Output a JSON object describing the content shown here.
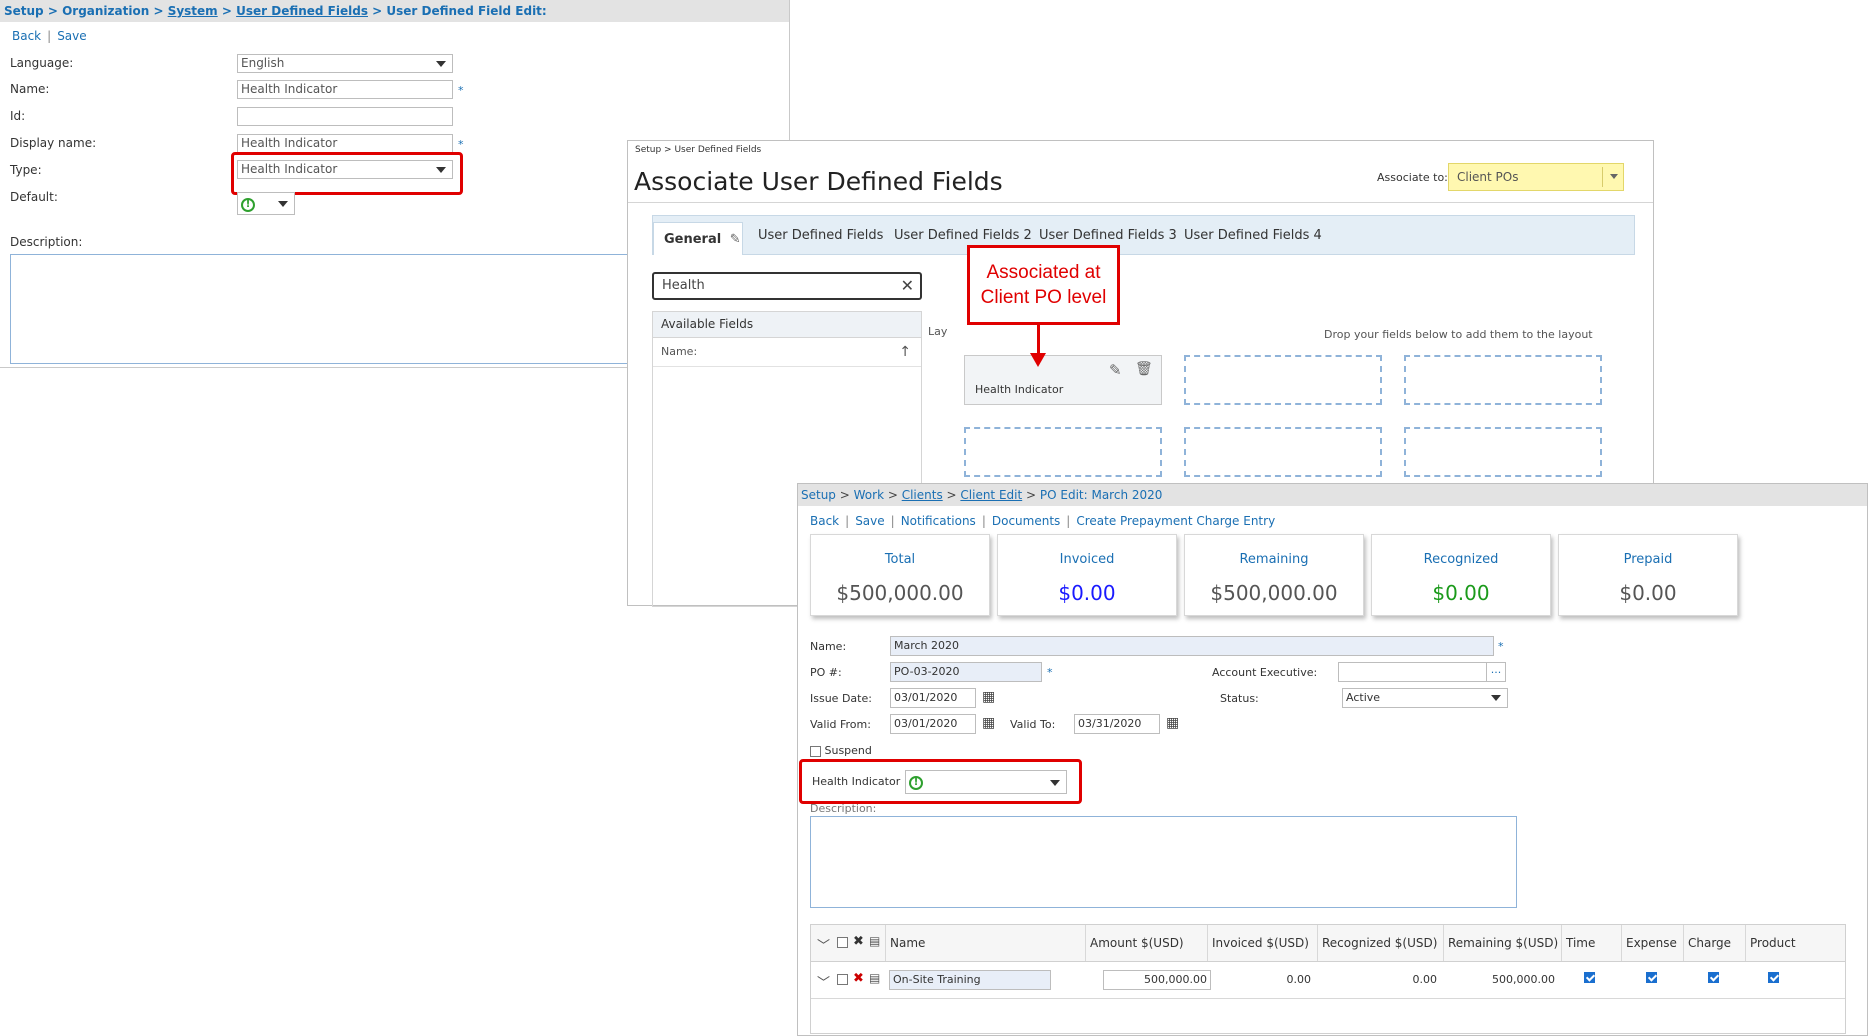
{
  "udf_edit": {
    "breadcrumb": [
      "Setup",
      "Organization",
      "System",
      "User Defined Fields",
      "User Defined Field Edit:"
    ],
    "actions": [
      "Back",
      "Save"
    ],
    "fields": {
      "language_label": "Language:",
      "language_value": "English",
      "name_label": "Name:",
      "name_value": "Health Indicator",
      "id_label": "Id:",
      "id_value": "",
      "display_label": "Display name:",
      "display_value": "Health Indicator",
      "type_label": "Type:",
      "type_value": "Health Indicator",
      "default_label": "Default:",
      "description_label": "Description:"
    },
    "required_mark": "*"
  },
  "associate": {
    "breadcrumb": "Setup > User Defined Fields",
    "title": "Associate User Defined Fields",
    "associate_label": "Associate to:",
    "associate_value": "Client POs",
    "tabs": [
      "General",
      "User Defined Fields",
      "User Defined Fields 2",
      "User Defined Fields 3",
      "User Defined Fields 4"
    ],
    "search_value": "Health",
    "available_header": "Available Fields",
    "name_column": "Name:",
    "layout_label": "Lay",
    "drop_hint": "Drop your fields below to add them to the layout",
    "placed_field": "Health Indicator",
    "highlight_color": "#fff8b0"
  },
  "callout": {
    "line1": "Associated at",
    "line2": "Client PO level",
    "color": "#e00000"
  },
  "po_edit": {
    "breadcrumb": [
      "Setup",
      "Work",
      "Clients",
      "Client Edit",
      "PO Edit: March 2020"
    ],
    "actions": [
      "Back",
      "Save",
      "Notifications",
      "Documents",
      "Create Prepayment Charge Entry"
    ],
    "cards": [
      {
        "title": "Total",
        "value": "$500,000.00",
        "color": "#555555"
      },
      {
        "title": "Invoiced",
        "value": "$0.00",
        "color": "#1a1aff"
      },
      {
        "title": "Remaining",
        "value": "$500,000.00",
        "color": "#555555"
      },
      {
        "title": "Recognized",
        "value": "$0.00",
        "color": "#1a9a1a"
      },
      {
        "title": "Prepaid",
        "value": "$0.00",
        "color": "#555555"
      }
    ],
    "name_label": "Name:",
    "name_value": "March 2020",
    "po_label": "PO #:",
    "po_value": "PO-03-2020",
    "ae_label": "Account Executive:",
    "ae_value": "",
    "ae_button": "...",
    "issue_label": "Issue Date:",
    "issue_value": "03/01/2020",
    "status_label": "Status:",
    "status_value": "Active",
    "valid_from_label": "Valid From:",
    "valid_from_value": "03/01/2020",
    "valid_to_label": "Valid To:",
    "valid_to_value": "03/31/2020",
    "suspend_label": "Suspend",
    "health_label": "Health Indicator",
    "description_label": "Description:",
    "grid": {
      "headers": [
        "Name",
        "Amount $(USD)",
        "Invoiced $(USD)",
        "Recognized $(USD)",
        "Remaining $(USD)",
        "Time",
        "Expense",
        "Charge",
        "Product"
      ],
      "row": {
        "name": "On-Site Training",
        "amount": "500,000.00",
        "invoiced": "0.00",
        "recognized": "0.00",
        "remaining": "500,000.00"
      }
    }
  }
}
